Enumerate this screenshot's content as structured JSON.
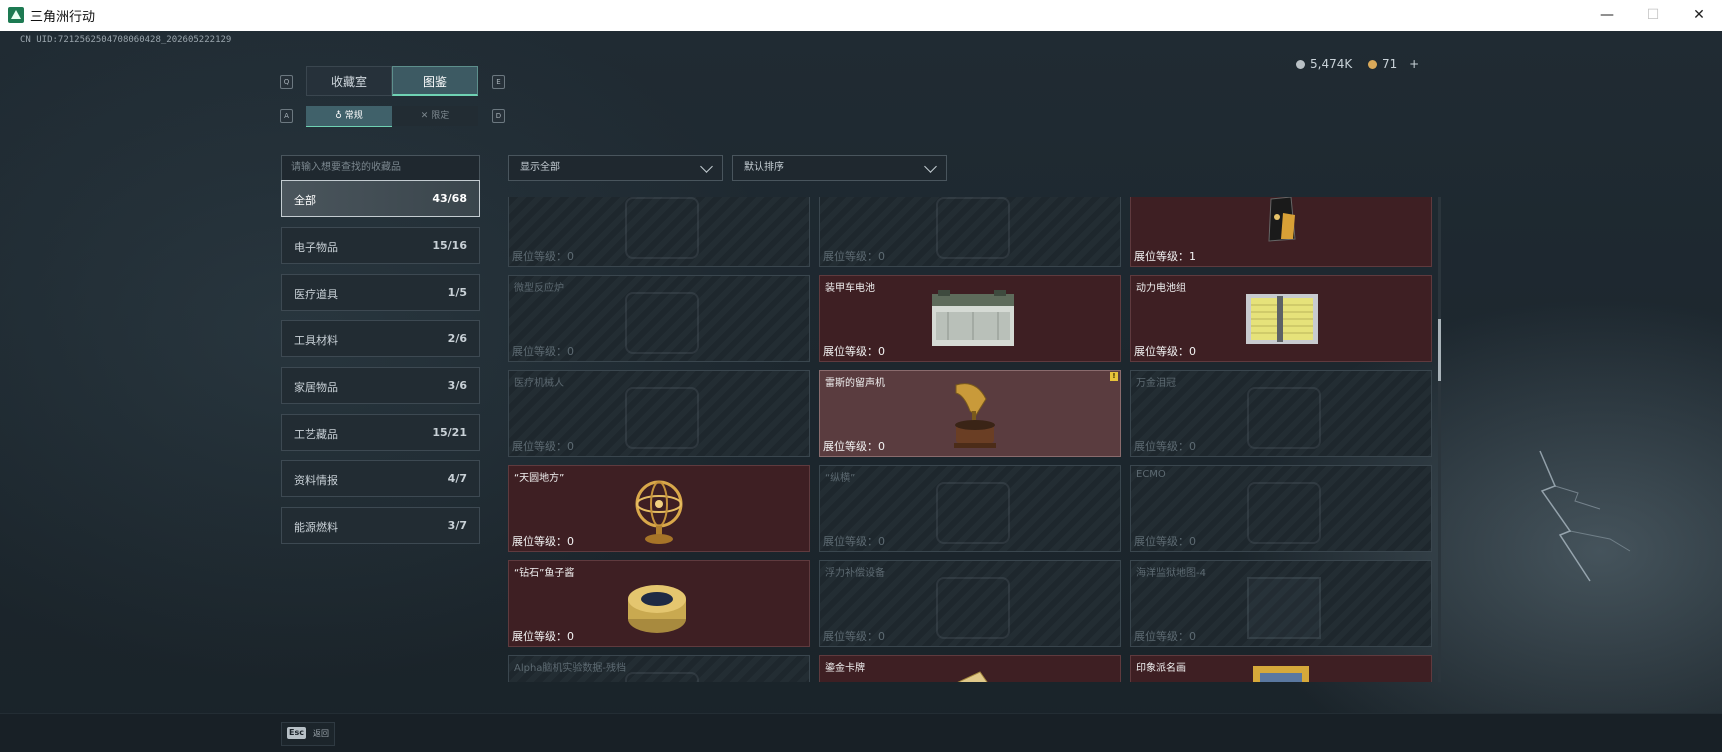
{
  "window": {
    "title": "三角洲行动",
    "minimize": "—",
    "maximize": "☐",
    "close": "✕"
  },
  "uid": "CN UID:7212562504708060428_202605222129",
  "currency": {
    "silver": "5,474K",
    "gold": "71",
    "add": "+",
    "silver_color": "#b9c0c5",
    "gold_color": "#d9a95a"
  },
  "tabs": {
    "key_left": "Q",
    "key_right": "E",
    "items": [
      {
        "label": "收藏室"
      },
      {
        "label": "图鉴"
      }
    ],
    "active": 1
  },
  "subtabs": {
    "key_left": "A",
    "key_right": "D",
    "items": [
      {
        "label": "常规",
        "icon": "flask-icon"
      },
      {
        "label": "限定",
        "icon": "crossed-swords-icon"
      }
    ],
    "active": 0
  },
  "search": {
    "placeholder": "请输入想要查找的收藏品"
  },
  "filters": {
    "show": "显示全部",
    "sort": "默认排序"
  },
  "categories": [
    {
      "label": "全部",
      "count": "43/68"
    },
    {
      "label": "电子物品",
      "count": "15/16"
    },
    {
      "label": "医疗道具",
      "count": "1/5"
    },
    {
      "label": "工具材料",
      "count": "2/6"
    },
    {
      "label": "家居物品",
      "count": "3/6"
    },
    {
      "label": "工艺藏品",
      "count": "15/21"
    },
    {
      "label": "资料情报",
      "count": "4/7"
    },
    {
      "label": "能源燃料",
      "count": "3/7"
    }
  ],
  "cards": [
    {
      "name": "",
      "level": "展位等级：0",
      "state": "locked"
    },
    {
      "name": "",
      "level": "展位等级：0",
      "state": "locked"
    },
    {
      "name": "",
      "level": "展位等级：1",
      "state": "owned",
      "icon": "bag-icon"
    },
    {
      "name": "微型反应炉",
      "level": "展位等级：0",
      "state": "locked"
    },
    {
      "name": "装甲车电池",
      "level": "展位等级：0",
      "state": "owned",
      "icon": "battery-icon"
    },
    {
      "name": "动力电池组",
      "level": "展位等级：0",
      "state": "owned",
      "icon": "battery-pack-icon"
    },
    {
      "name": "医疗机械人",
      "level": "展位等级：0",
      "state": "locked"
    },
    {
      "name": "雷斯的留声机",
      "level": "展位等级：0",
      "state": "highlight",
      "icon": "gramophone-icon",
      "badge": "!"
    },
    {
      "name": "万金泪冠",
      "level": "展位等级：0",
      "state": "locked"
    },
    {
      "name": "“天圆地方”",
      "level": "展位等级：0",
      "state": "owned",
      "icon": "armillary-sphere-icon"
    },
    {
      "name": "“纵横”",
      "level": "展位等级：0",
      "state": "locked"
    },
    {
      "name": "ECMO",
      "level": "展位等级：0",
      "state": "locked"
    },
    {
      "name": "“钻石”鱼子酱",
      "level": "展位等级：0",
      "state": "owned",
      "icon": "caviar-tin-icon"
    },
    {
      "name": "浮力补偿设备",
      "level": "展位等级：0",
      "state": "locked"
    },
    {
      "name": "海洋监狱地图-4",
      "level": "展位等级：0",
      "state": "locked"
    },
    {
      "name": "Alpha脑机实验数据-残档",
      "level": "",
      "state": "locked"
    },
    {
      "name": "鎏金卡牌",
      "level": "",
      "state": "owned",
      "icon": "gilded-card-icon"
    },
    {
      "name": "印象派名画",
      "level": "",
      "state": "owned",
      "icon": "painting-icon"
    }
  ],
  "footer": {
    "key": "Esc",
    "label": "返回"
  }
}
